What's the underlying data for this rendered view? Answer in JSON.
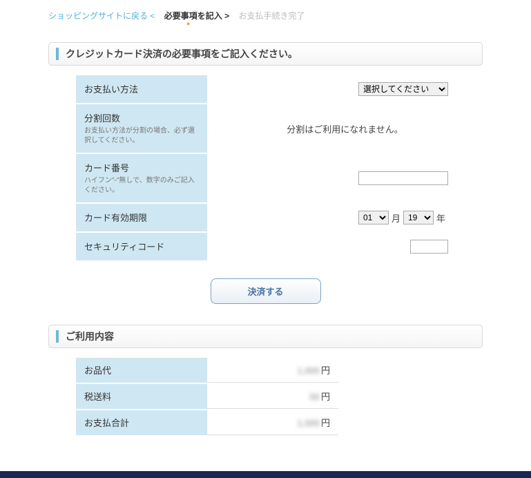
{
  "breadcrumb": {
    "back": "ショッピングサイトに戻る",
    "sep_back": "<",
    "step1": "必要事項を記入",
    "sep1": ">",
    "step2": "お支払手続き完了"
  },
  "section_head": "クレジットカード決済の必要事項をご記入ください。",
  "form": {
    "method": {
      "label": "お支払い方法",
      "placeholder": "選択してください"
    },
    "installments": {
      "label": "分割回数",
      "sub": "お支払い方法が分割の場合、必ず選択してください。",
      "message": "分割はご利用になれません。"
    },
    "card": {
      "label": "カード番号",
      "sub": "ハイフン\"-\"無しで、数字のみご記入ください。"
    },
    "expiry": {
      "label": "カード有効期限",
      "month": "01",
      "month_suffix": "月",
      "year": "19",
      "year_suffix": "年"
    },
    "security": {
      "label": "セキュリティコード"
    }
  },
  "submit": "決済する",
  "usage_head": "ご利用内容",
  "usage": {
    "item": {
      "label": "お品代",
      "masked": "1,000",
      "unit": "円"
    },
    "shipping": {
      "label": "税送料",
      "masked": "00",
      "unit": "円"
    },
    "total": {
      "label": "お支払合計",
      "masked": "1,000",
      "unit": "円"
    }
  }
}
